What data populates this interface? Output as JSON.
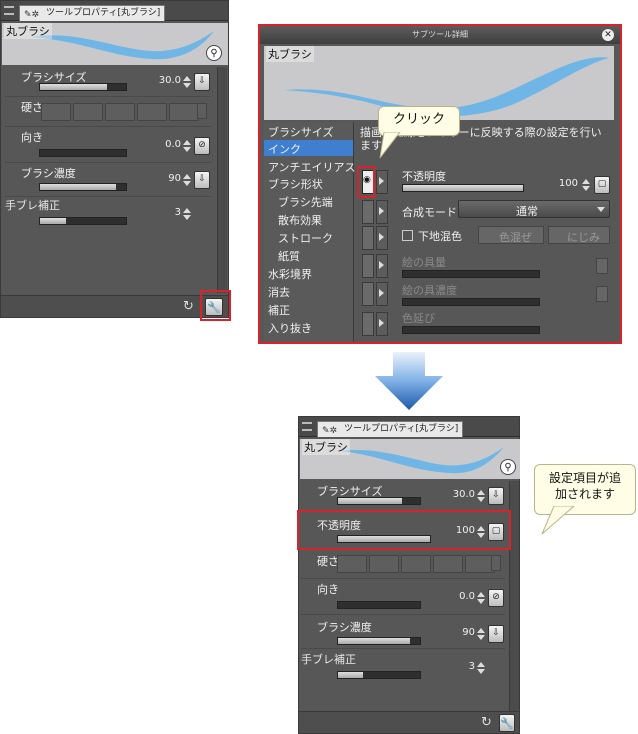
{
  "left_panel": {
    "tab_title": "ツールプロパティ[丸ブラシ]",
    "preview_label": "丸ブラシ",
    "brush_size": {
      "label": "ブラシサイズ",
      "value": "30.0",
      "fill": 0.78
    },
    "hardness": {
      "label": "硬さ"
    },
    "direction": {
      "label": "向き",
      "value": "0.0",
      "fill": 0.0
    },
    "brush_density": {
      "label": "ブラシ濃度",
      "value": "90",
      "fill": 0.88
    },
    "stabilization": {
      "label": "手ブレ補正",
      "value": "3",
      "fill": 0.3
    }
  },
  "sub_tool_detail": {
    "title": "サブツール詳細",
    "preview_label": "丸ブラシ",
    "categories": [
      "ブラシサイズ",
      "インク",
      "アンチエイリアス",
      "ブラシ形状",
      "ブラシ先端",
      "散布効果",
      "ストローク",
      "紙質",
      "水彩境界",
      "消去",
      "補正",
      "入り抜き"
    ],
    "selected_category": "インク",
    "description": "描画した線をレイヤーに反映する際の設定を行います。",
    "opacity": {
      "label": "不透明度",
      "value": "100",
      "fill": 1.0
    },
    "blend_mode": {
      "label": "合成モード",
      "value": "通常"
    },
    "underlayer_mix": {
      "label": "下地混色",
      "color_mix": "色混ぜ",
      "bleed": "にじみ"
    },
    "paint_amount": {
      "label": "絵の具量"
    },
    "paint_density": {
      "label": "絵の具濃度"
    },
    "color_stretch": {
      "label": "色延び"
    },
    "callout": "クリック"
  },
  "result_panel": {
    "tab_title": "ツールプロパティ[丸ブラシ]",
    "preview_label": "丸ブラシ",
    "brush_size": {
      "label": "ブラシサイズ",
      "value": "30.0",
      "fill": 0.78
    },
    "opacity": {
      "label": "不透明度",
      "value": "100",
      "fill": 1.0
    },
    "hardness": {
      "label": "硬さ"
    },
    "direction": {
      "label": "向き",
      "value": "0.0",
      "fill": 0.0
    },
    "brush_density": {
      "label": "ブラシ濃度",
      "value": "90",
      "fill": 0.88
    },
    "stabilization": {
      "label": "手ブレ補正",
      "value": "3",
      "fill": 0.3
    },
    "callout": "設定項目が追加されます"
  },
  "colors": {
    "highlight": "#d8232a",
    "arrow": "#2f6fc0",
    "selected": "#3f7fd0"
  }
}
